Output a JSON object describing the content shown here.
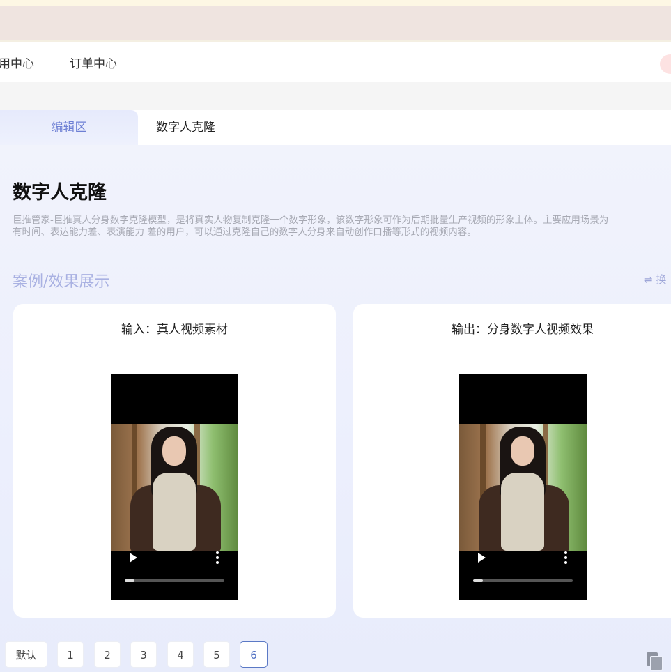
{
  "nav": {
    "items": [
      "用中心",
      "订单中心"
    ]
  },
  "tabs": {
    "active_label": "编辑区",
    "second_label": "数字人克隆"
  },
  "page": {
    "title": "数字人克隆",
    "description_line1": "巨推管家-巨推真人分身数字克隆模型，是将真实人物复制克隆一个数字形象，该数字形象可作为后期批量生产视频的形象主体。主要应用场景为",
    "description_line2": "有时间、表达能力差、表演能力 差的用户，可以通过克隆自己的数字人分身来自动创作口播等形式的视频内容。"
  },
  "showcase": {
    "title": "案例/效果展示",
    "switch_label": "⇌ 换",
    "input_card": {
      "header": "输入：真人视频素材",
      "progress": 0.1
    },
    "output_card": {
      "header": "输出：分身数字人视频效果",
      "progress": 0.1
    }
  },
  "pagination": {
    "default_label": "默认",
    "pages": [
      "1",
      "2",
      "3",
      "4",
      "5",
      "6"
    ],
    "active_page": "6"
  },
  "icons": {
    "play": "play-icon",
    "more": "more-vertical-icon",
    "switch": "switch-arrows-icon",
    "copy": "copy-icon"
  },
  "colors": {
    "accent": "#6d7fd4",
    "section_title": "#a9b1e2",
    "active_page_border": "#5b79c5"
  }
}
